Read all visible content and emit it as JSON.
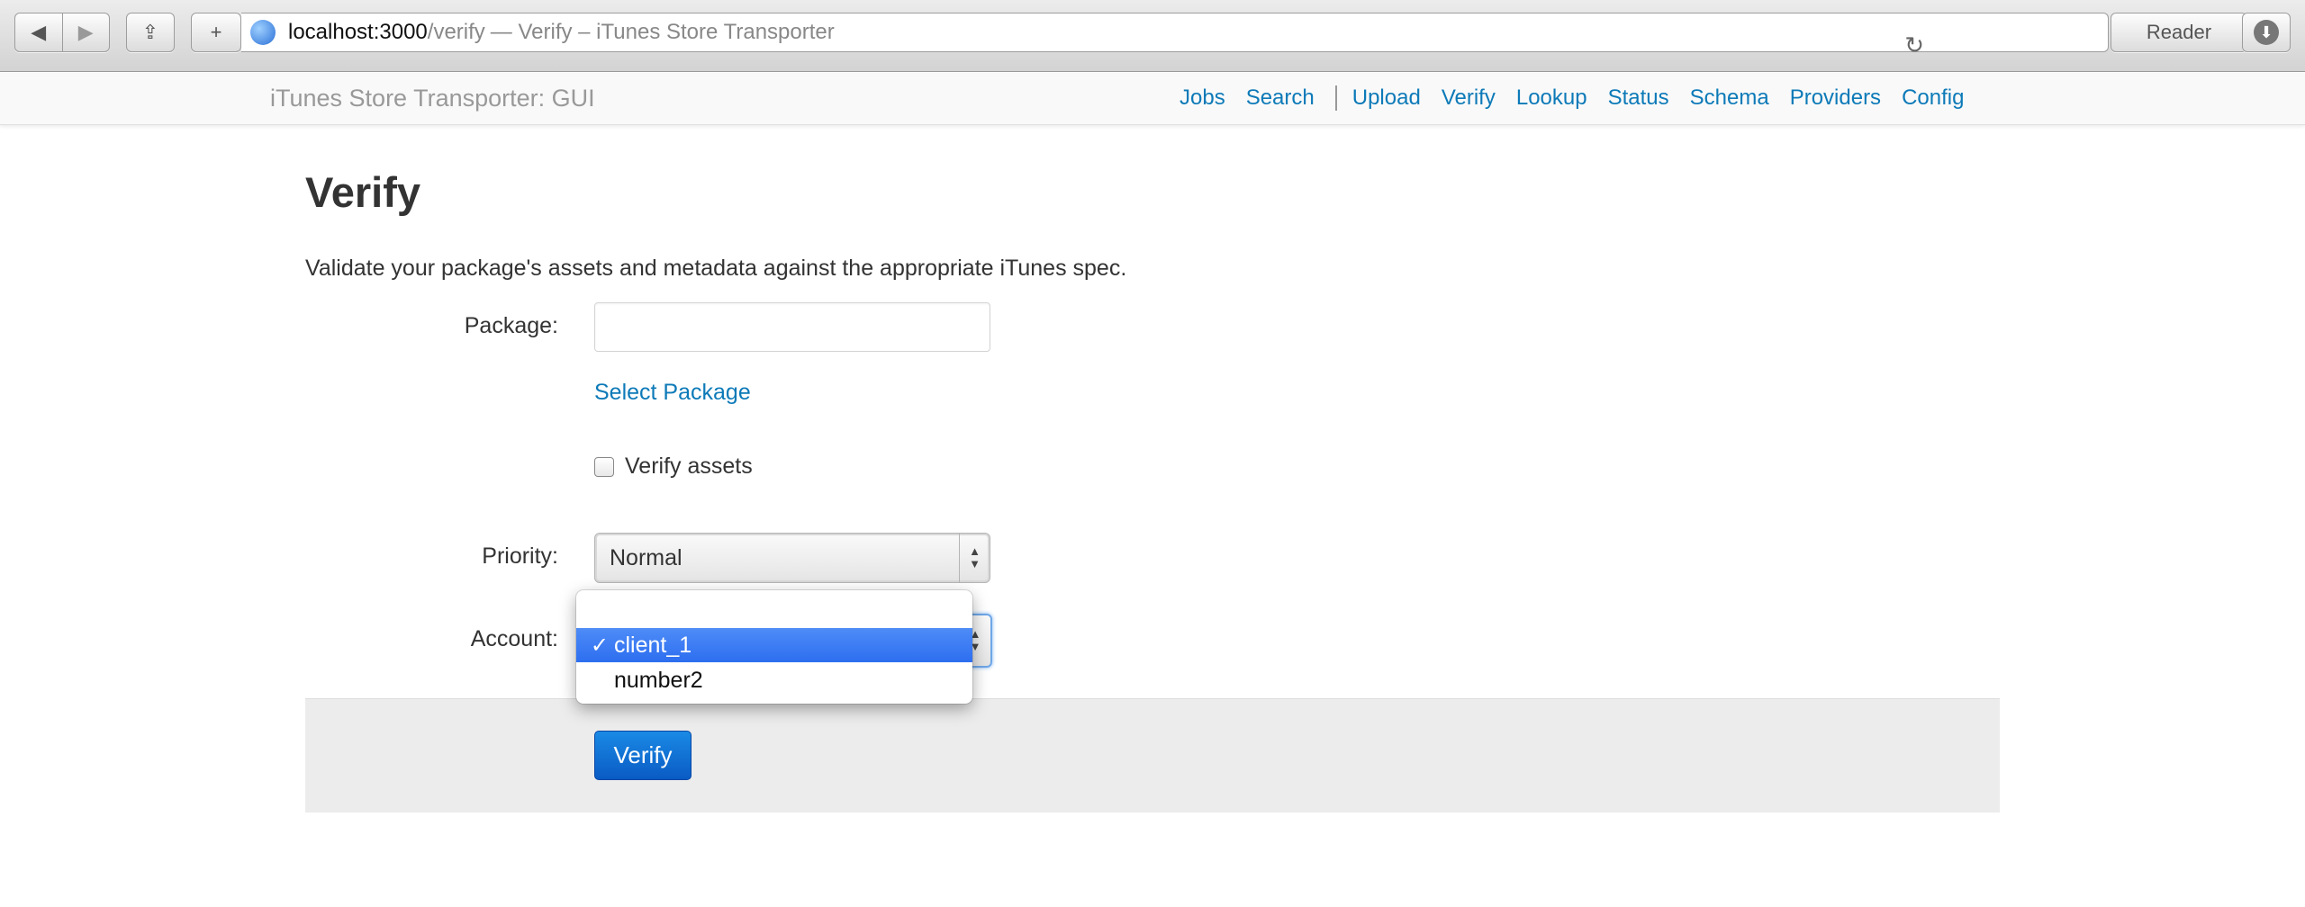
{
  "browser": {
    "url_host": "localhost:3000",
    "url_path": "/verify",
    "page_title": "— Verify – iTunes Store Transporter",
    "reader_label": "Reader"
  },
  "navbar": {
    "brand": "iTunes Store Transporter: GUI",
    "links": [
      "Jobs",
      "Search",
      "Upload",
      "Verify",
      "Lookup",
      "Status",
      "Schema",
      "Providers",
      "Config"
    ]
  },
  "page": {
    "title": "Verify",
    "lead": "Validate your package's assets and metadata against the appropriate iTunes spec."
  },
  "form": {
    "package_label": "Package:",
    "package_value": "",
    "select_package_link": "Select Package",
    "verify_assets_label": "Verify assets",
    "verify_assets_checked": false,
    "priority_label": "Priority:",
    "priority_value": "Normal",
    "account_label": "Account:",
    "account_options": [
      "",
      "client_1",
      "number2"
    ],
    "account_selected": "client_1",
    "submit_label": "Verify"
  },
  "colors": {
    "link": "#0d7ab8",
    "primary_button": "#0a5bc4",
    "selected_option": "#2d6ef0"
  }
}
